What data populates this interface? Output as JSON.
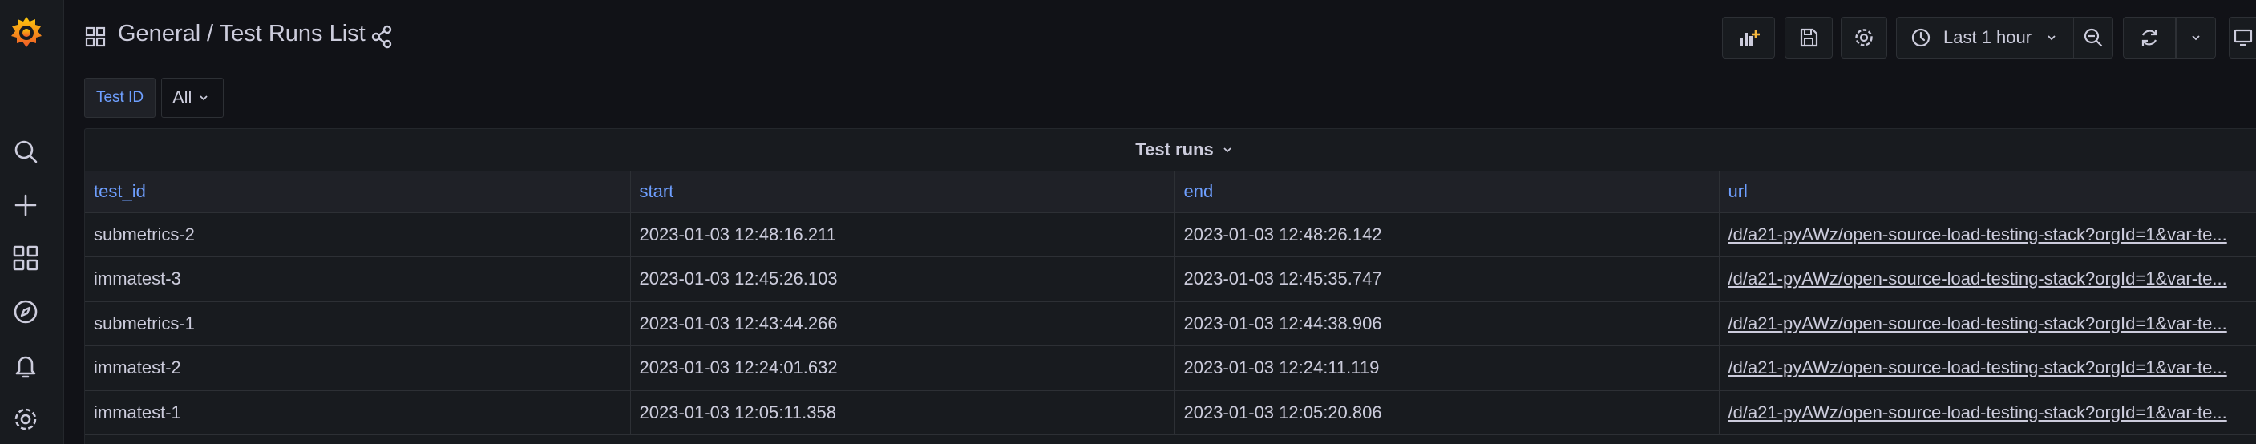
{
  "sidebar": {
    "items": [
      "search-icon",
      "plus-icon",
      "dashboards-icon",
      "explore-icon",
      "alerting-icon",
      "settings-icon"
    ]
  },
  "header": {
    "folder": "General",
    "title": "/ Test Runs List"
  },
  "toolbar": {
    "time_range": "Last 1 hour"
  },
  "variables": {
    "label": "Test ID",
    "value": "All"
  },
  "panel": {
    "title": "Test runs",
    "columns": [
      "test_id",
      "start",
      "end",
      "url"
    ],
    "rows": [
      [
        "submetrics-2",
        "2023-01-03 12:48:16.211",
        "2023-01-03 12:48:26.142",
        "/d/a21-pyAWz/open-source-load-testing-stack?orgId=1&var-te..."
      ],
      [
        "immatest-3",
        "2023-01-03 12:45:26.103",
        "2023-01-03 12:45:35.747",
        "/d/a21-pyAWz/open-source-load-testing-stack?orgId=1&var-te..."
      ],
      [
        "submetrics-1",
        "2023-01-03 12:43:44.266",
        "2023-01-03 12:44:38.906",
        "/d/a21-pyAWz/open-source-load-testing-stack?orgId=1&var-te..."
      ],
      [
        "immatest-2",
        "2023-01-03 12:24:01.632",
        "2023-01-03 12:24:11.119",
        "/d/a21-pyAWz/open-source-load-testing-stack?orgId=1&var-te..."
      ],
      [
        "immatest-1",
        "2023-01-03 12:05:11.358",
        "2023-01-03 12:05:20.806",
        "/d/a21-pyAWz/open-source-load-testing-stack?orgId=1&var-te..."
      ]
    ]
  },
  "colors": {
    "background": "#111217",
    "panel": "#181b1f",
    "header_text": "#6e9fff",
    "brand": "#f05a28"
  }
}
